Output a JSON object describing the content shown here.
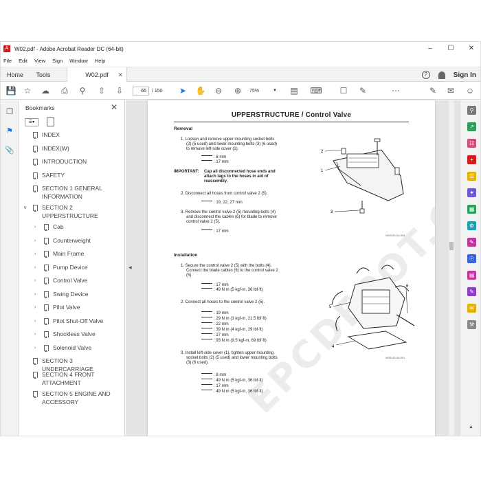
{
  "window": {
    "title": "W02.pdf - Adobe Acrobat Reader DC (64-bit)"
  },
  "menu": [
    "File",
    "Edit",
    "View",
    "Sign",
    "Window",
    "Help"
  ],
  "tabs": {
    "home": "Home",
    "tools": "Tools",
    "document": "W02.pdf"
  },
  "header": {
    "sign_in": "Sign In"
  },
  "toolbar": {
    "page_current": "65",
    "page_total": "/ 150",
    "zoom": "75%"
  },
  "bookmarks": {
    "title": "Bookmarks",
    "items": [
      {
        "label": "INDEX",
        "level": 0,
        "expand": ""
      },
      {
        "label": "INDEX(W)",
        "level": 0,
        "expand": ""
      },
      {
        "label": "INTRODUCTION",
        "level": 0,
        "expand": ""
      },
      {
        "label": "SAFETY",
        "level": 0,
        "expand": ""
      },
      {
        "label": "SECTION 1 GENERAL",
        "label2": "INFORMATION",
        "level": 0,
        "expand": ""
      },
      {
        "label": "SECTION 2",
        "label2": "UPPERSTRUCTURE",
        "level": 0,
        "expand": "open"
      },
      {
        "label": "Cab",
        "level": 1,
        "expand": "closed"
      },
      {
        "label": "Counterweight",
        "level": 1,
        "expand": "closed"
      },
      {
        "label": "Main Frame",
        "level": 1,
        "expand": "closed"
      },
      {
        "label": "Pump Device",
        "level": 1,
        "expand": "closed"
      },
      {
        "label": "Control Valve",
        "level": 1,
        "expand": "closed"
      },
      {
        "label": "Swing Device",
        "level": 1,
        "expand": "closed"
      },
      {
        "label": "Pilot Valve",
        "level": 1,
        "expand": "closed"
      },
      {
        "label": "Pilot Shut-Off Valve",
        "level": 1,
        "expand": "closed"
      },
      {
        "label": "Shockless Valve",
        "level": 1,
        "expand": "closed"
      },
      {
        "label": "Solenoid Valve",
        "level": 1,
        "expand": "closed"
      },
      {
        "label": "SECTION 3 UNDERCARRIAGE",
        "level": 0,
        "expand": ""
      },
      {
        "label": "SECTION 4 FRONT",
        "label2": "ATTACHMENT",
        "level": 0,
        "expand": ""
      },
      {
        "label": "SECTION 5 ENGINE AND",
        "label2": "ACCESSORY",
        "level": 0,
        "expand": ""
      }
    ]
  },
  "page": {
    "title": "UPPERSTRUCTURE / Control Valve",
    "removal_heading": "Removal",
    "r1a": "1. Loosen and remove upper mounting socket bolts",
    "r1b": "(2) (5 used) and lower mounting bolts (3) (6 used)",
    "r1c": "to remove left-side cover (1).",
    "r1s1": ": 8 mm",
    "r1s2": ": 17 mm",
    "important_label": "IMPORTANT:",
    "important_a": "Cap all disconnected hose ends and",
    "important_b": "attach tags to the hoses in aid of",
    "important_c": "reassembly.",
    "r2": "2. Disconnect all hoses from control valve 2 (5).",
    "r2s1": ": 19, 22, 27 mm",
    "r3a": "3. Remove the control valve 2 (5) mounting bolts (4)",
    "r3b": "and disconnect the cables (6) for blade to remove",
    "r3c": "control valve 2 (5).",
    "r3s1": ": 17 mm",
    "installation_heading": "Installation",
    "i1a": "1. Secure the control valve 2 (5) with the bolts (4).",
    "i1b": "Connect the blade cables (6) to the control valve 2",
    "i1c": "(5).",
    "i1s1": ": 17 mm",
    "i1s2": ": 49 N m (5 kgf-m, 36 lbf·ft)",
    "i2": "2. Connect all hoses to the control valve 2 (5).",
    "i2s1": ": 19 mm",
    "i2s2": ": 29 N m (3 kgf-m, 21.5 lbf·ft)",
    "i2s3": ": 22 mm",
    "i2s4": ": 39 N m (4 kgf-m, 29 lbf·ft)",
    "i2s5": ": 27 mm",
    "i2s6": ": 93 N m (9.5 kgf-m, 69 lbf·ft)",
    "i3a": "3. Install left-side cover (1), tighten upper mounting",
    "i3b": "socket bolts (2) (5 used) and lower mounting bolts",
    "i3c": "(3) (6 used).",
    "i3s1": ": 8 mm",
    "i3s2": ": 49 N m (5 kgf-m, 36 lbf·ft)",
    "i3s3": ": 17 mm",
    "i3s4": ": 49 N m (5 kgf-m, 36 lbf·ft)",
    "fig1_code": "W1B-03-04-003",
    "fig2_code": "W1B-03-04-001",
    "callouts1": [
      "2",
      "1",
      "3"
    ],
    "callouts2": [
      "6",
      "5",
      "4"
    ],
    "watermark": "EPCDEPOT.COM"
  },
  "colors": {
    "accent": "#1473e6",
    "brand": "#d7191c"
  }
}
